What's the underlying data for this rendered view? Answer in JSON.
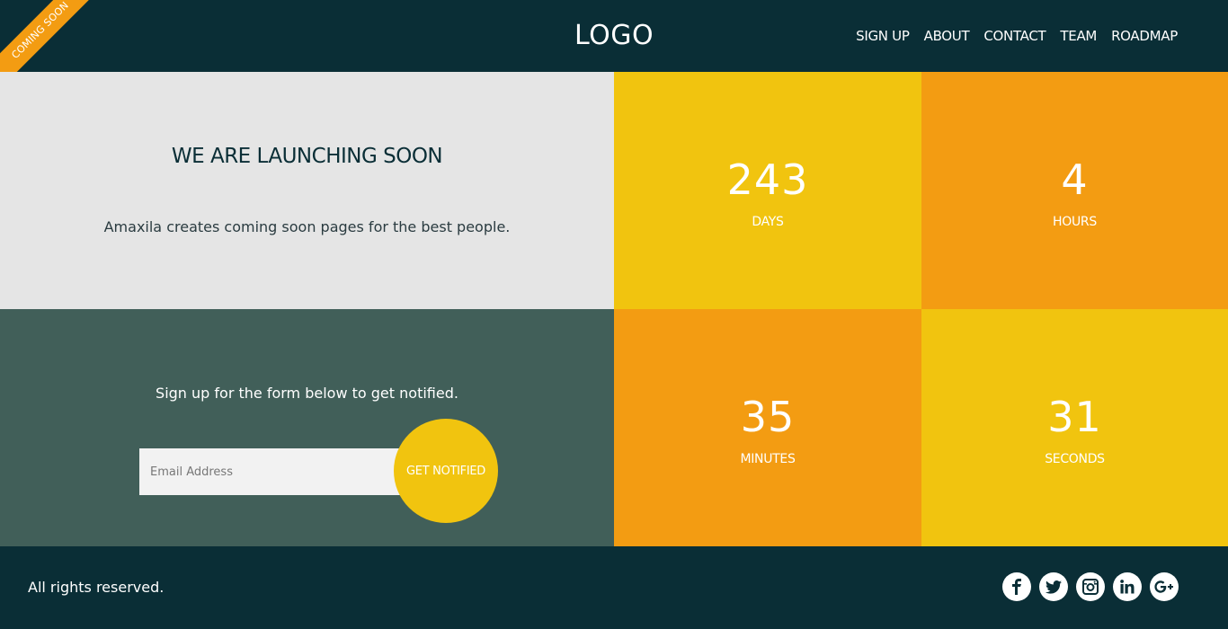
{
  "ribbon": {
    "label": "COMING SOON"
  },
  "header": {
    "logo": "LOGO",
    "nav": [
      {
        "label": "SIGN UP"
      },
      {
        "label": "ABOUT"
      },
      {
        "label": "CONTACT"
      },
      {
        "label": "TEAM"
      },
      {
        "label": "ROADMAP"
      }
    ]
  },
  "intro": {
    "title": "WE ARE LAUNCHING SOON",
    "text": "Amaxila creates coming soon pages for the best people."
  },
  "signup": {
    "text": "Sign up for the form below to get notified.",
    "email_placeholder": "Email Address",
    "email_value": "",
    "button_label": "GET NOTIFIED"
  },
  "countdown": {
    "days": {
      "value": "243",
      "label": "DAYS"
    },
    "hours": {
      "value": "4",
      "label": "HOURS"
    },
    "minutes": {
      "value": "35",
      "label": "MINUTES"
    },
    "seconds": {
      "value": "31",
      "label": "SECONDS"
    }
  },
  "footer": {
    "rights": "All rights reserved.",
    "social": [
      "facebook-icon",
      "twitter-icon",
      "instagram-icon",
      "linkedin-icon",
      "google-plus-icon"
    ]
  },
  "colors": {
    "dark": "#0a2e36",
    "light_panel": "#e5e5e5",
    "green_panel": "#415f59",
    "yellow": "#f1c40f",
    "orange": "#f39c12"
  }
}
